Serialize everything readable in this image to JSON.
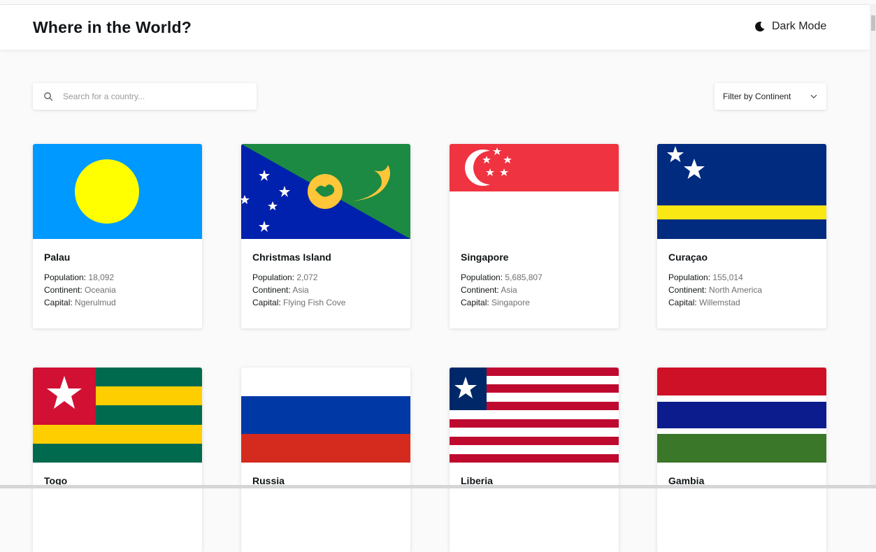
{
  "header": {
    "title": "Where in the World?",
    "dark_mode_label": "Dark Mode"
  },
  "search": {
    "placeholder": "Search for a country..."
  },
  "filter": {
    "label": "Filter by Continent"
  },
  "labels": {
    "population": "Population:",
    "continent": "Continent:",
    "capital": "Capital:"
  },
  "cards": [
    {
      "name": "Palau",
      "population": "18,092",
      "continent": "Oceania",
      "capital": "Ngerulmud",
      "flag_icon": "palau-flag"
    },
    {
      "name": "Christmas Island",
      "population": "2,072",
      "continent": "Asia",
      "capital": "Flying Fish Cove",
      "flag_icon": "christmas-island-flag"
    },
    {
      "name": "Singapore",
      "population": "5,685,807",
      "continent": "Asia",
      "capital": "Singapore",
      "flag_icon": "singapore-flag"
    },
    {
      "name": "Curaçao",
      "population": "155,014",
      "continent": "North America",
      "capital": "Willemstad",
      "flag_icon": "curacao-flag"
    },
    {
      "name": "Togo",
      "flag_icon": "togo-flag"
    },
    {
      "name": "Russia",
      "flag_icon": "russia-flag"
    },
    {
      "name": "Liberia",
      "flag_icon": "liberia-flag"
    },
    {
      "name": "Gambia",
      "flag_icon": "gambia-flag"
    }
  ],
  "colors": {
    "background": "#fafafa",
    "card": "#ffffff",
    "text": "#111517",
    "muted": "#707070"
  }
}
